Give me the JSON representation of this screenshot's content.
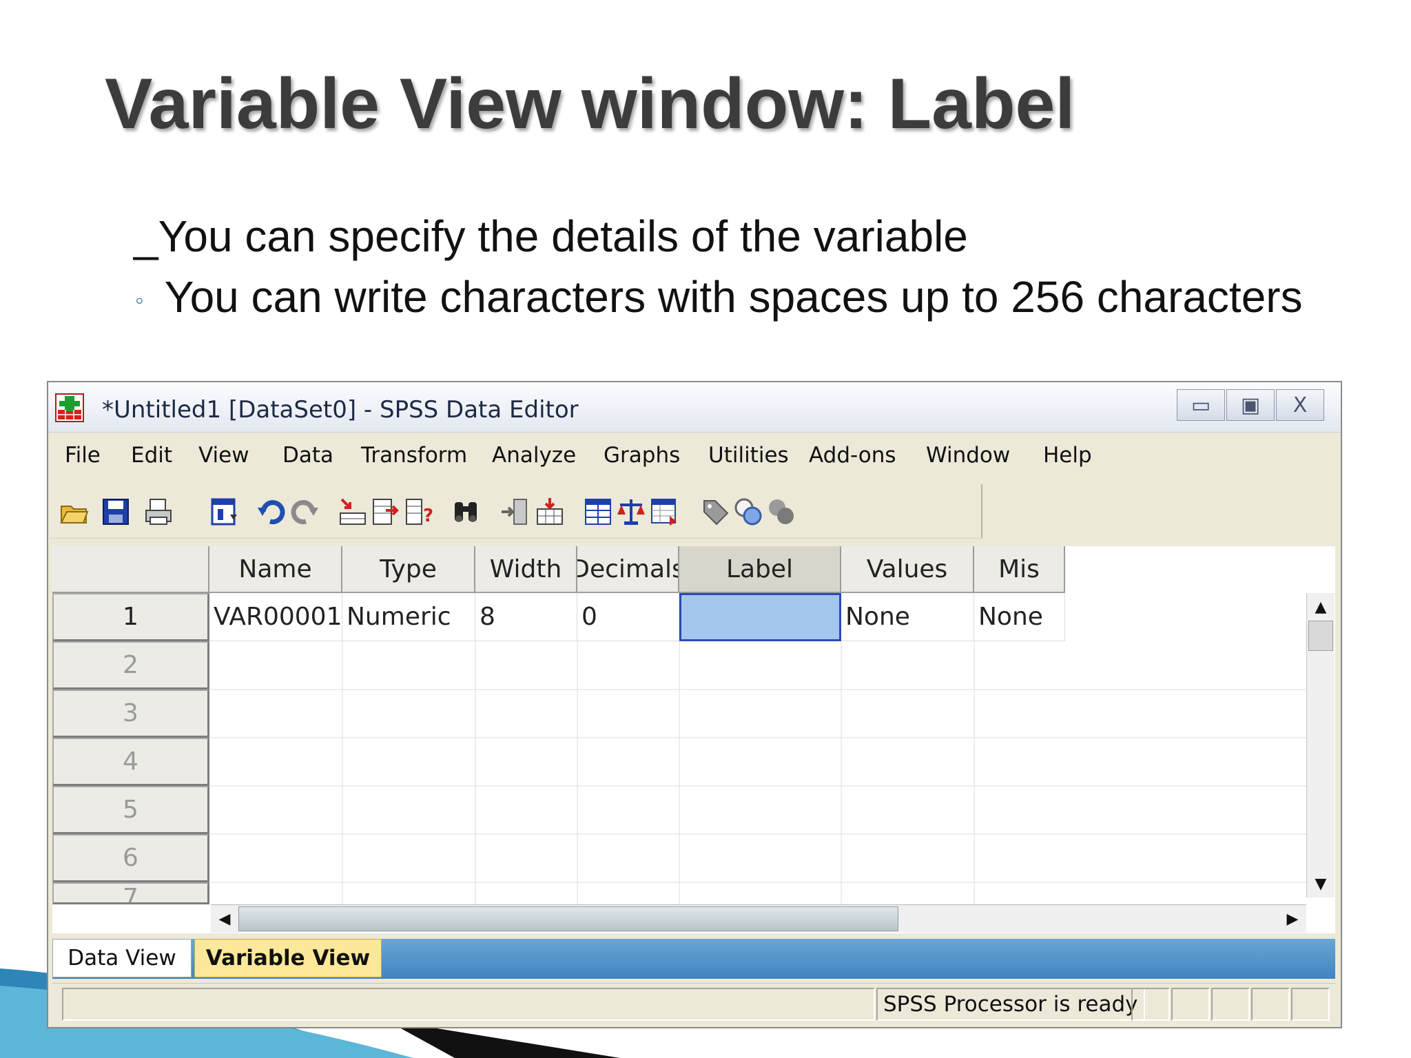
{
  "slide": {
    "title": "Variable View window: Label",
    "bullet_1": "_You can specify the details of the variable",
    "bullet_2_marker": "◦",
    "bullet_2": "You can write characters with spaces up to 256 characters"
  },
  "window": {
    "title": "*Untitled1 [DataSet0] - SPSS Data Editor",
    "controls": {
      "minimize": "▭",
      "maximize": "▣",
      "close": "X"
    }
  },
  "menu": [
    "File",
    "Edit",
    "View",
    "Data",
    "Transform",
    "Analyze",
    "Graphs",
    "Utilities",
    "Add-ons",
    "Window",
    "Help"
  ],
  "grid": {
    "columns": [
      "Name",
      "Type",
      "Width",
      "Decimals",
      "Label",
      "Values",
      "Mis"
    ],
    "row_numbers": [
      "1",
      "2",
      "3",
      "4",
      "5",
      "6",
      "7"
    ],
    "rows": [
      [
        "VAR00001",
        "Numeric",
        "8",
        "0",
        "",
        "None",
        "None"
      ]
    ]
  },
  "tabs": {
    "data_view": "Data View",
    "variable_view": "Variable View"
  },
  "status": {
    "message": "SPSS  Processor is ready"
  },
  "colors": {
    "selected_cell": "#a4c6ec",
    "selection_border": "#2a49b8",
    "active_tab": "#fce89a",
    "tab_bar": "#3f84c0"
  }
}
